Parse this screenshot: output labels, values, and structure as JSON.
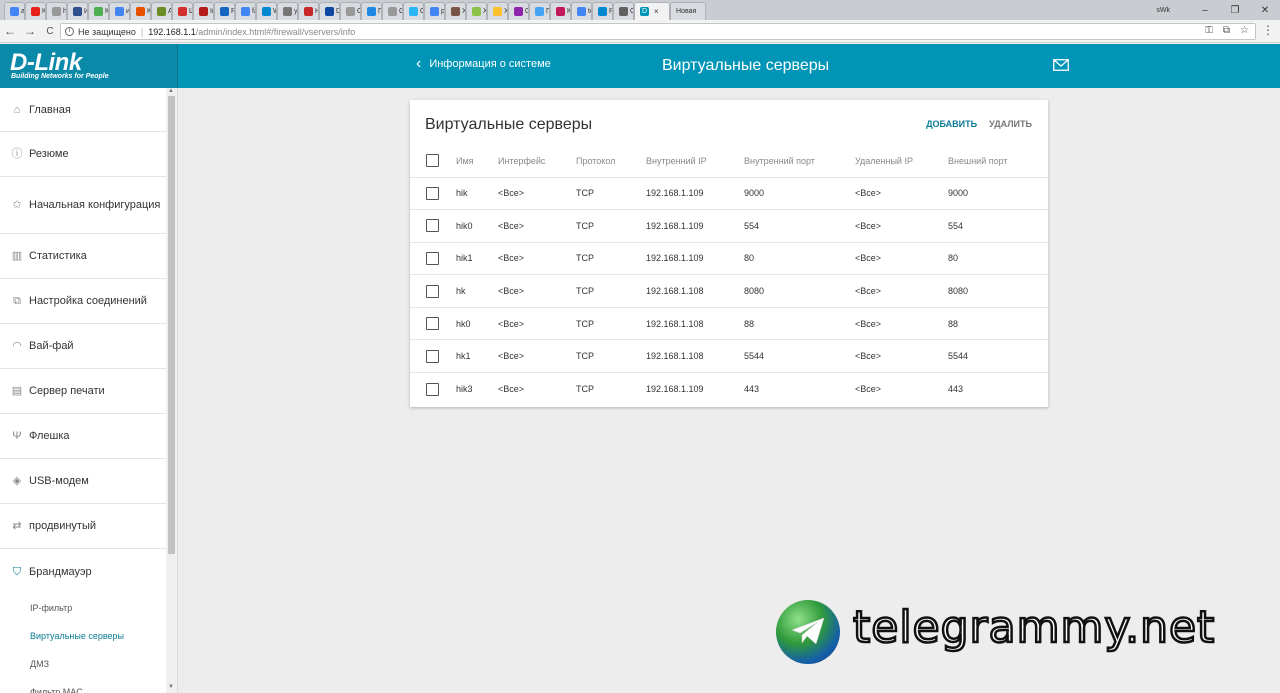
{
  "browser": {
    "tabs": [
      {
        "label": "am",
        "color": "#4285f4"
      },
      {
        "label": "Кр",
        "color": "#e62117"
      },
      {
        "label": "htt",
        "color": "#999999"
      },
      {
        "label": "Ин",
        "color": "#2f4f8f"
      },
      {
        "label": "Ку",
        "color": "#4caf50"
      },
      {
        "label": "ин",
        "color": "#4285f4"
      },
      {
        "label": "Ку",
        "color": "#e65100"
      },
      {
        "label": "Ав",
        "color": "#6b8e23"
      },
      {
        "label": "Ш",
        "color": "#d32f2f"
      },
      {
        "label": "Ind",
        "color": "#b71c1c"
      },
      {
        "label": "РА",
        "color": "#1565c0"
      },
      {
        "label": "fac",
        "color": "#4285f4"
      },
      {
        "label": "W",
        "color": "#0288d1"
      },
      {
        "label": "yo",
        "color": "#777777"
      },
      {
        "label": "На",
        "color": "#c62828"
      },
      {
        "label": "D-",
        "color": "#0d47a1"
      },
      {
        "label": "Co",
        "color": "#999999"
      },
      {
        "label": "Пр",
        "color": "#1e88e5"
      },
      {
        "label": "Co",
        "color": "#999999"
      },
      {
        "label": "Cб",
        "color": "#29b6f6"
      },
      {
        "label": "ра",
        "color": "#4285f4"
      },
      {
        "label": "Ха",
        "color": "#795548"
      },
      {
        "label": "Ха",
        "color": "#8bc34a"
      },
      {
        "label": "Ха",
        "color": "#fbc02d"
      },
      {
        "label": "Ос",
        "color": "#8e24aa"
      },
      {
        "label": "Пр",
        "color": "#42a5f5"
      },
      {
        "label": "Ко",
        "color": "#c2185b"
      },
      {
        "label": "tel",
        "color": "#4285f4"
      },
      {
        "label": "Ра",
        "color": "#0288d1"
      },
      {
        "label": "Сх",
        "color": "#616161"
      }
    ],
    "active_tab": {
      "label": "D",
      "close": "×",
      "color": "#0095b6"
    },
    "new_tab": "Новая",
    "user_label": "sWk",
    "window_controls": {
      "minimize": "–",
      "maximize": "❐",
      "close": "✕"
    },
    "nav": {
      "back": "←",
      "forward": "→",
      "reload": "C"
    },
    "address": {
      "security": "Не защищено",
      "host": "192.168.1.1",
      "path": "/admin/index.html#/firewall/vservers/info"
    }
  },
  "header": {
    "logo": "D-Link",
    "logo_tagline": "Building Networks for People",
    "back_label": "Информация о системе",
    "title": "Виртуальные серверы"
  },
  "sidebar": {
    "items": [
      {
        "label": "Главная",
        "icon": "home-icon",
        "glyph": "⌂"
      },
      {
        "label": "Резюме",
        "icon": "info-icon",
        "glyph": "ⓘ"
      },
      {
        "label": "Начальная конфигурация",
        "icon": "magic-wand-icon",
        "glyph": "✩"
      },
      {
        "label": "Статистика",
        "icon": "bar-chart-icon",
        "glyph": "▥"
      },
      {
        "label": "Настройка соединений",
        "icon": "connections-icon",
        "glyph": "⧉"
      },
      {
        "label": "Вай-фай",
        "icon": "wifi-icon",
        "glyph": "◠"
      },
      {
        "label": "Сервер печати",
        "icon": "printer-icon",
        "glyph": "▤"
      },
      {
        "label": "Флешка",
        "icon": "usb-icon",
        "glyph": "Ψ"
      },
      {
        "label": "USB-модем",
        "icon": "modem-icon",
        "glyph": "◈"
      },
      {
        "label": "продвинутый",
        "icon": "advanced-icon",
        "glyph": "⇄"
      },
      {
        "label": "Брандмауэр",
        "icon": "shield-icon",
        "glyph": "⛉"
      }
    ],
    "sub_items": [
      {
        "label": "IP-фильтр",
        "active": false
      },
      {
        "label": "Виртуальные серверы",
        "active": true
      },
      {
        "label": "ДМЗ",
        "active": false
      },
      {
        "label": "Фильтр MAC",
        "active": false
      }
    ]
  },
  "card": {
    "title": "Виртуальные серверы",
    "add_label": "ДОБАВИТЬ",
    "delete_label": "УДАЛИТЬ",
    "columns": [
      "Имя",
      "Интерфейс",
      "Протокол",
      "Внутренний IP",
      "Внутренний порт",
      "Удаленный IP",
      "Внешний порт"
    ],
    "rows": [
      [
        "hik",
        "<Все>",
        "TCP",
        "192.168.1.109",
        "9000",
        "<Все>",
        "9000"
      ],
      [
        "hik0",
        "<Все>",
        "TCP",
        "192.168.1.109",
        "554",
        "<Все>",
        "554"
      ],
      [
        "hik1",
        "<Все>",
        "TCP",
        "192.168.1.109",
        "80",
        "<Все>",
        "80"
      ],
      [
        "hk",
        "<Все>",
        "TCP",
        "192.168.1.108",
        "8080",
        "<Все>",
        "8080"
      ],
      [
        "hk0",
        "<Все>",
        "TCP",
        "192.168.1.108",
        "88",
        "<Все>",
        "88"
      ],
      [
        "hk1",
        "<Все>",
        "TCP",
        "192.168.1.108",
        "5544",
        "<Все>",
        "5544"
      ],
      [
        "hik3",
        "<Все>",
        "TCP",
        "192.168.1.109",
        "443",
        "<Все>",
        "443"
      ]
    ]
  },
  "watermark": "telegrammy.net",
  "colors": {
    "brand": "#0095b6",
    "accent": "#0a7b95"
  }
}
